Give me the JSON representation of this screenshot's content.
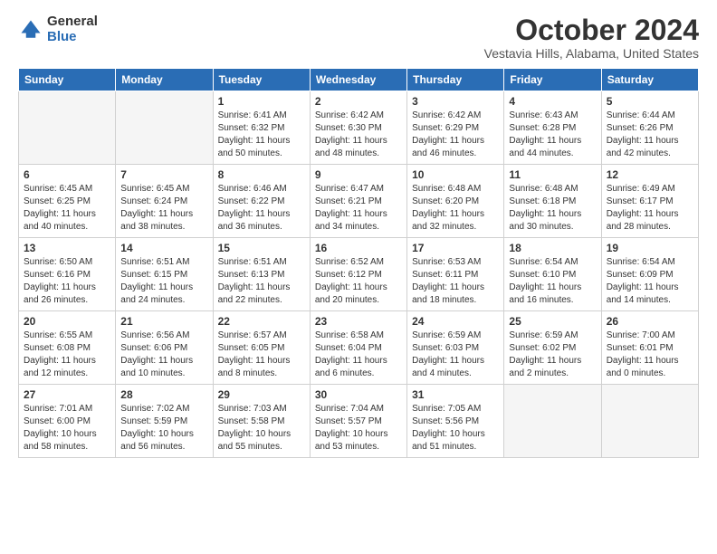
{
  "header": {
    "logo_general": "General",
    "logo_blue": "Blue",
    "month_title": "October 2024",
    "location": "Vestavia Hills, Alabama, United States"
  },
  "weekdays": [
    "Sunday",
    "Monday",
    "Tuesday",
    "Wednesday",
    "Thursday",
    "Friday",
    "Saturday"
  ],
  "weeks": [
    [
      {
        "num": "",
        "empty": true
      },
      {
        "num": "",
        "empty": true
      },
      {
        "num": "1",
        "sunrise": "6:41 AM",
        "sunset": "6:32 PM",
        "daylight": "11 hours and 50 minutes."
      },
      {
        "num": "2",
        "sunrise": "6:42 AM",
        "sunset": "6:30 PM",
        "daylight": "11 hours and 48 minutes."
      },
      {
        "num": "3",
        "sunrise": "6:42 AM",
        "sunset": "6:29 PM",
        "daylight": "11 hours and 46 minutes."
      },
      {
        "num": "4",
        "sunrise": "6:43 AM",
        "sunset": "6:28 PM",
        "daylight": "11 hours and 44 minutes."
      },
      {
        "num": "5",
        "sunrise": "6:44 AM",
        "sunset": "6:26 PM",
        "daylight": "11 hours and 42 minutes."
      }
    ],
    [
      {
        "num": "6",
        "sunrise": "6:45 AM",
        "sunset": "6:25 PM",
        "daylight": "11 hours and 40 minutes."
      },
      {
        "num": "7",
        "sunrise": "6:45 AM",
        "sunset": "6:24 PM",
        "daylight": "11 hours and 38 minutes."
      },
      {
        "num": "8",
        "sunrise": "6:46 AM",
        "sunset": "6:22 PM",
        "daylight": "11 hours and 36 minutes."
      },
      {
        "num": "9",
        "sunrise": "6:47 AM",
        "sunset": "6:21 PM",
        "daylight": "11 hours and 34 minutes."
      },
      {
        "num": "10",
        "sunrise": "6:48 AM",
        "sunset": "6:20 PM",
        "daylight": "11 hours and 32 minutes."
      },
      {
        "num": "11",
        "sunrise": "6:48 AM",
        "sunset": "6:18 PM",
        "daylight": "11 hours and 30 minutes."
      },
      {
        "num": "12",
        "sunrise": "6:49 AM",
        "sunset": "6:17 PM",
        "daylight": "11 hours and 28 minutes."
      }
    ],
    [
      {
        "num": "13",
        "sunrise": "6:50 AM",
        "sunset": "6:16 PM",
        "daylight": "11 hours and 26 minutes."
      },
      {
        "num": "14",
        "sunrise": "6:51 AM",
        "sunset": "6:15 PM",
        "daylight": "11 hours and 24 minutes."
      },
      {
        "num": "15",
        "sunrise": "6:51 AM",
        "sunset": "6:13 PM",
        "daylight": "11 hours and 22 minutes."
      },
      {
        "num": "16",
        "sunrise": "6:52 AM",
        "sunset": "6:12 PM",
        "daylight": "11 hours and 20 minutes."
      },
      {
        "num": "17",
        "sunrise": "6:53 AM",
        "sunset": "6:11 PM",
        "daylight": "11 hours and 18 minutes."
      },
      {
        "num": "18",
        "sunrise": "6:54 AM",
        "sunset": "6:10 PM",
        "daylight": "11 hours and 16 minutes."
      },
      {
        "num": "19",
        "sunrise": "6:54 AM",
        "sunset": "6:09 PM",
        "daylight": "11 hours and 14 minutes."
      }
    ],
    [
      {
        "num": "20",
        "sunrise": "6:55 AM",
        "sunset": "6:08 PM",
        "daylight": "11 hours and 12 minutes."
      },
      {
        "num": "21",
        "sunrise": "6:56 AM",
        "sunset": "6:06 PM",
        "daylight": "11 hours and 10 minutes."
      },
      {
        "num": "22",
        "sunrise": "6:57 AM",
        "sunset": "6:05 PM",
        "daylight": "11 hours and 8 minutes."
      },
      {
        "num": "23",
        "sunrise": "6:58 AM",
        "sunset": "6:04 PM",
        "daylight": "11 hours and 6 minutes."
      },
      {
        "num": "24",
        "sunrise": "6:59 AM",
        "sunset": "6:03 PM",
        "daylight": "11 hours and 4 minutes."
      },
      {
        "num": "25",
        "sunrise": "6:59 AM",
        "sunset": "6:02 PM",
        "daylight": "11 hours and 2 minutes."
      },
      {
        "num": "26",
        "sunrise": "7:00 AM",
        "sunset": "6:01 PM",
        "daylight": "11 hours and 0 minutes."
      }
    ],
    [
      {
        "num": "27",
        "sunrise": "7:01 AM",
        "sunset": "6:00 PM",
        "daylight": "10 hours and 58 minutes."
      },
      {
        "num": "28",
        "sunrise": "7:02 AM",
        "sunset": "5:59 PM",
        "daylight": "10 hours and 56 minutes."
      },
      {
        "num": "29",
        "sunrise": "7:03 AM",
        "sunset": "5:58 PM",
        "daylight": "10 hours and 55 minutes."
      },
      {
        "num": "30",
        "sunrise": "7:04 AM",
        "sunset": "5:57 PM",
        "daylight": "10 hours and 53 minutes."
      },
      {
        "num": "31",
        "sunrise": "7:05 AM",
        "sunset": "5:56 PM",
        "daylight": "10 hours and 51 minutes."
      },
      {
        "num": "",
        "empty": true
      },
      {
        "num": "",
        "empty": true
      }
    ]
  ]
}
